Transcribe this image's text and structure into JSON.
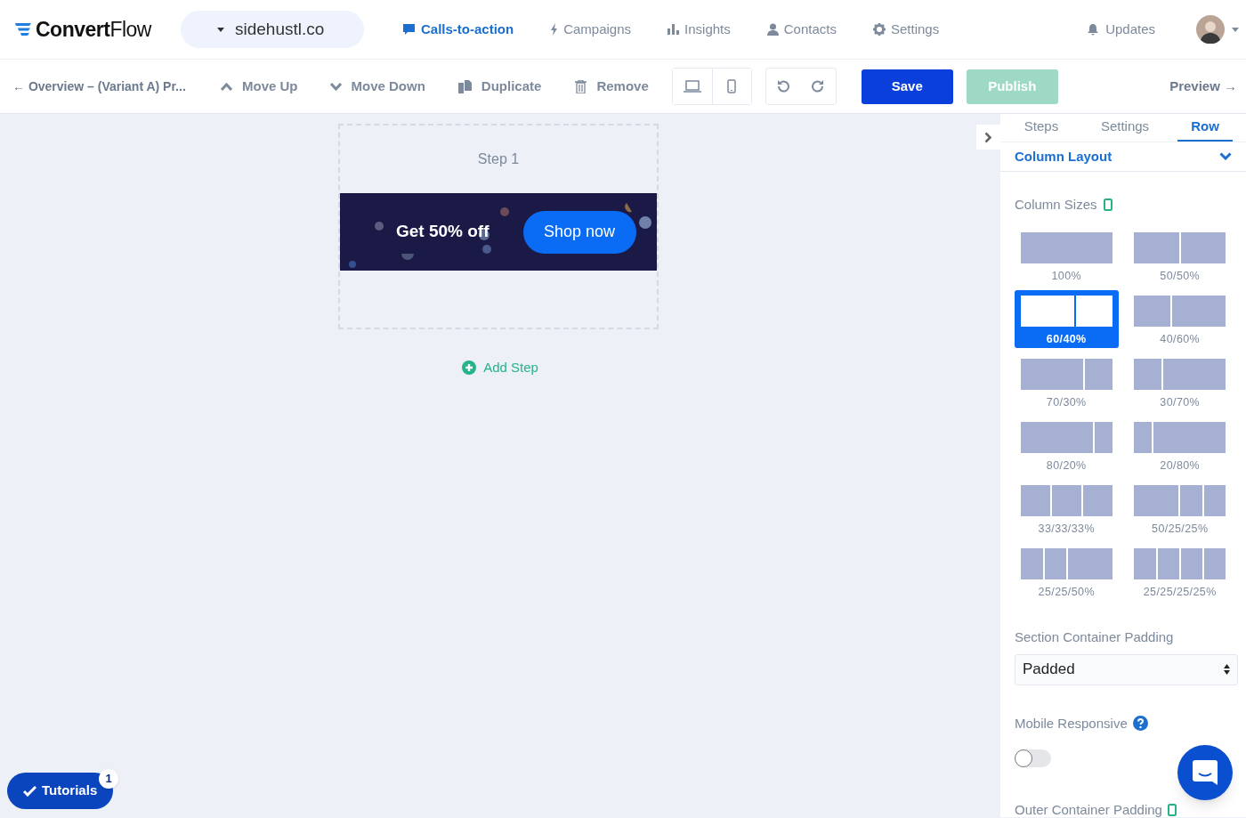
{
  "brand": {
    "name_part1": "Convert",
    "name_part2": "Flow"
  },
  "site_selector": {
    "value": "sidehustl.co"
  },
  "nav": [
    {
      "label": "Calls-to-action",
      "selected": true
    },
    {
      "label": "Campaigns",
      "selected": false
    },
    {
      "label": "Insights",
      "selected": false
    },
    {
      "label": "Contacts",
      "selected": false
    },
    {
      "label": "Settings",
      "selected": false
    }
  ],
  "updates": {
    "label": "Updates"
  },
  "breadcrumb": "← Overview – **(Variant A) Pr...**",
  "toolbar": [
    {
      "label": "Move Up"
    },
    {
      "label": "Move Down"
    },
    {
      "label": "Duplicate"
    },
    {
      "label": "Remove"
    }
  ],
  "device_toggle": [
    {
      "kind": "desktop",
      "selected": false
    },
    {
      "kind": "mobile",
      "selected": false
    }
  ],
  "save_button": "Save",
  "publish_button": {
    "label": "Publish",
    "disabled": true
  },
  "preview_link": "Preview →",
  "canvas": {
    "step_title": "Step 1",
    "banner": {
      "headline": "Get 50% off",
      "button": "Shop now"
    },
    "add_step": "Add Step"
  },
  "panel": {
    "tabs": [
      {
        "label": "Steps",
        "selected": false
      },
      {
        "label": "Settings",
        "selected": false
      },
      {
        "label": "Row",
        "selected": true
      }
    ],
    "section": {
      "title": "Column Layout",
      "expanded": true
    },
    "column_sizes_label": "Column Sizes",
    "column_options": [
      {
        "label": "100%",
        "selected": false
      },
      {
        "label": "50/50%",
        "selected": false
      },
      {
        "label": "60/40%",
        "selected": true
      },
      {
        "label": "40/60%",
        "selected": false
      },
      {
        "label": "70/30%",
        "selected": false
      },
      {
        "label": "30/70%",
        "selected": false
      },
      {
        "label": "80/20%",
        "selected": false
      },
      {
        "label": "20/80%",
        "selected": false
      },
      {
        "label": "33/33/33%",
        "selected": false
      },
      {
        "label": "50/25/25%",
        "selected": false
      },
      {
        "label": "25/25/50%",
        "selected": false
      },
      {
        "label": "25/25/25/25%",
        "selected": false
      }
    ],
    "padding": {
      "label": "Section Container Padding",
      "value": "Padded"
    },
    "mobile_responsive": {
      "label": "Mobile Responsive",
      "on": false
    },
    "outer_padding_label": "Outer Container Padding"
  },
  "tutorials": {
    "label": "Tutorials",
    "badge": "1"
  }
}
